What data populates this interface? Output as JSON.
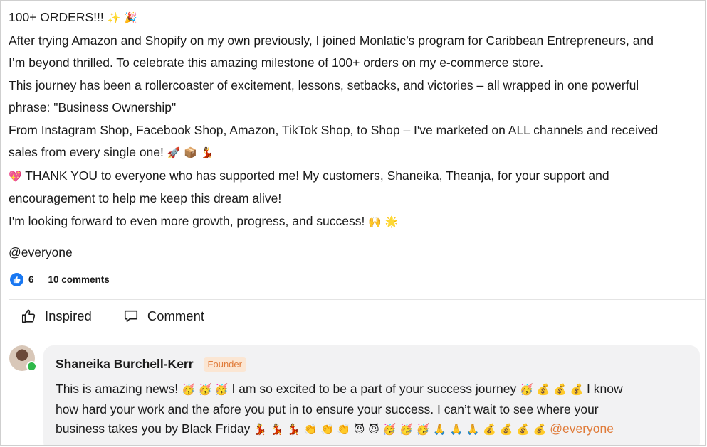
{
  "post": {
    "lines": [
      {
        "text": "100+ ORDERS!!!",
        "emoji": "✨ 🎉"
      },
      {
        "text": "After trying Amazon and Shopify on my own previously, I joined Monlatic’s program for Caribbean Entrepreneurs, and",
        "emoji": ""
      },
      {
        "text": "I’m beyond thrilled. To celebrate this amazing milestone of 100+ orders on my e-commerce store.",
        "emoji": ""
      },
      {
        "text": "This journey has been a rollercoaster of excitement, lessons, setbacks, and victories – all wrapped in one powerful",
        "emoji": ""
      },
      {
        "text": "phrase: \"Business Ownership\"",
        "emoji": ""
      },
      {
        "text": "From Instagram Shop, Facebook Shop, Amazon, TikTok Shop, to Shop – I've marketed on ALL channels and received",
        "emoji": ""
      },
      {
        "text": "sales from every single one!",
        "emoji": "🚀 📦 💃"
      },
      {
        "text": "THANK YOU to everyone who has supported me! My customers, Shaneika, Theanja, for your support and",
        "emoji": "💖"
      },
      {
        "text": "encouragement to help me keep this dream alive!",
        "emoji": ""
      },
      {
        "text": "I'm looking forward to even more growth, progress, and success!",
        "emoji": "🙌 🌟"
      }
    ],
    "mention": "@everyone"
  },
  "stats": {
    "likes": "6",
    "comments": "10 comments"
  },
  "actions": {
    "inspired_label": "Inspired",
    "comment_label": "Comment"
  },
  "comment": {
    "author": "Shaneika Burchell-Kerr",
    "role": "Founder",
    "line1_text": "This is amazing news!",
    "line1_emoji_a": "🥳 🥳 🥳",
    "line1_text_b": "I am so excited to be a part of your success journey",
    "line1_emoji_b": "🥳 💰 💰 💰",
    "line1_text_c": "I know",
    "line2_text": "how hard your work and the afore you put in to ensure your success. I can’t wait to see where your",
    "line3_text": "business takes you by Black Friday",
    "line3_emoji": "💃 💃 💃 👏 👏 👏 😈 😈 🥳 🥳 🥳 🙏 🙏 🙏 💰 💰 💰 💰",
    "line3_mention": "@everyone"
  },
  "colors": {
    "accent": "#e07b39",
    "like_blue": "#1877f2",
    "online_green": "#2fb84a",
    "card_bg": "#f2f2f3"
  },
  "icons": {
    "like": "thumbs-up-icon",
    "inspired": "thumbs-up-outline-icon",
    "comment": "speech-bubble-icon"
  }
}
